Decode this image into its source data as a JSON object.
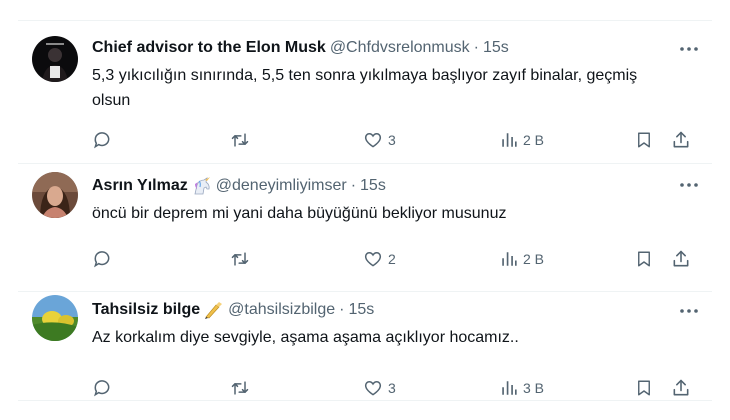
{
  "tweets": [
    {
      "name": "Chief advisor to the Elon Musk",
      "handle": "@Chfdvsrelonmusk",
      "separator": "·",
      "time": "15s",
      "emoji": "",
      "text": "5,3 yıkıcılığın sınırında, 5,5 ten sonra yıkılmaya başlıyor zayıf binalar, geçmiş olsun",
      "likes": "3",
      "views": "2 B",
      "avatar": "avatar-dark-portrait"
    },
    {
      "name": "Asrın Yılmaz",
      "handle": "@deneyimliyimser",
      "separator": "·",
      "time": "15s",
      "emoji": "unicorn-emoji",
      "text": "öncü bir deprem mi yani daha büyüğünü bekliyor musunuz",
      "likes": "2",
      "views": "2 B",
      "avatar": "avatar-woman-portrait"
    },
    {
      "name": "Tahsilsiz bilge",
      "handle": "@tahsilsizbilge",
      "separator": "·",
      "time": "15s",
      "emoji": "writing-hand-emoji",
      "text": "Az korkalım diye sevgiyle, aşama aşama açıklıyor hocamız..",
      "likes": "3",
      "views": "3 B",
      "avatar": "avatar-landscape"
    }
  ],
  "colors": {
    "text": "#0f1419",
    "muted": "#536471",
    "border": "#eff3f4"
  }
}
